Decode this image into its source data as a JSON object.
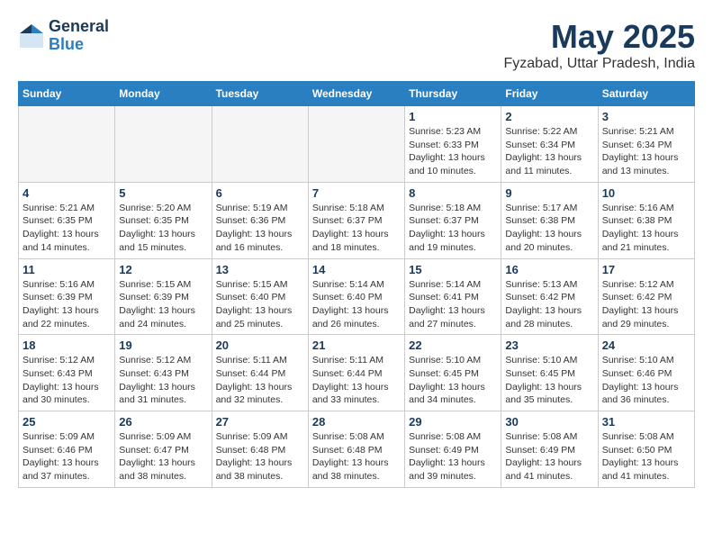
{
  "logo": {
    "general": "General",
    "blue": "Blue"
  },
  "title": "May 2025",
  "location": "Fyzabad, Uttar Pradesh, India",
  "days_of_week": [
    "Sunday",
    "Monday",
    "Tuesday",
    "Wednesday",
    "Thursday",
    "Friday",
    "Saturday"
  ],
  "weeks": [
    [
      {
        "day": "",
        "info": ""
      },
      {
        "day": "",
        "info": ""
      },
      {
        "day": "",
        "info": ""
      },
      {
        "day": "",
        "info": ""
      },
      {
        "day": "1",
        "info": "Sunrise: 5:23 AM\nSunset: 6:33 PM\nDaylight: 13 hours\nand 10 minutes."
      },
      {
        "day": "2",
        "info": "Sunrise: 5:22 AM\nSunset: 6:34 PM\nDaylight: 13 hours\nand 11 minutes."
      },
      {
        "day": "3",
        "info": "Sunrise: 5:21 AM\nSunset: 6:34 PM\nDaylight: 13 hours\nand 13 minutes."
      }
    ],
    [
      {
        "day": "4",
        "info": "Sunrise: 5:21 AM\nSunset: 6:35 PM\nDaylight: 13 hours\nand 14 minutes."
      },
      {
        "day": "5",
        "info": "Sunrise: 5:20 AM\nSunset: 6:35 PM\nDaylight: 13 hours\nand 15 minutes."
      },
      {
        "day": "6",
        "info": "Sunrise: 5:19 AM\nSunset: 6:36 PM\nDaylight: 13 hours\nand 16 minutes."
      },
      {
        "day": "7",
        "info": "Sunrise: 5:18 AM\nSunset: 6:37 PM\nDaylight: 13 hours\nand 18 minutes."
      },
      {
        "day": "8",
        "info": "Sunrise: 5:18 AM\nSunset: 6:37 PM\nDaylight: 13 hours\nand 19 minutes."
      },
      {
        "day": "9",
        "info": "Sunrise: 5:17 AM\nSunset: 6:38 PM\nDaylight: 13 hours\nand 20 minutes."
      },
      {
        "day": "10",
        "info": "Sunrise: 5:16 AM\nSunset: 6:38 PM\nDaylight: 13 hours\nand 21 minutes."
      }
    ],
    [
      {
        "day": "11",
        "info": "Sunrise: 5:16 AM\nSunset: 6:39 PM\nDaylight: 13 hours\nand 22 minutes."
      },
      {
        "day": "12",
        "info": "Sunrise: 5:15 AM\nSunset: 6:39 PM\nDaylight: 13 hours\nand 24 minutes."
      },
      {
        "day": "13",
        "info": "Sunrise: 5:15 AM\nSunset: 6:40 PM\nDaylight: 13 hours\nand 25 minutes."
      },
      {
        "day": "14",
        "info": "Sunrise: 5:14 AM\nSunset: 6:40 PM\nDaylight: 13 hours\nand 26 minutes."
      },
      {
        "day": "15",
        "info": "Sunrise: 5:14 AM\nSunset: 6:41 PM\nDaylight: 13 hours\nand 27 minutes."
      },
      {
        "day": "16",
        "info": "Sunrise: 5:13 AM\nSunset: 6:42 PM\nDaylight: 13 hours\nand 28 minutes."
      },
      {
        "day": "17",
        "info": "Sunrise: 5:12 AM\nSunset: 6:42 PM\nDaylight: 13 hours\nand 29 minutes."
      }
    ],
    [
      {
        "day": "18",
        "info": "Sunrise: 5:12 AM\nSunset: 6:43 PM\nDaylight: 13 hours\nand 30 minutes."
      },
      {
        "day": "19",
        "info": "Sunrise: 5:12 AM\nSunset: 6:43 PM\nDaylight: 13 hours\nand 31 minutes."
      },
      {
        "day": "20",
        "info": "Sunrise: 5:11 AM\nSunset: 6:44 PM\nDaylight: 13 hours\nand 32 minutes."
      },
      {
        "day": "21",
        "info": "Sunrise: 5:11 AM\nSunset: 6:44 PM\nDaylight: 13 hours\nand 33 minutes."
      },
      {
        "day": "22",
        "info": "Sunrise: 5:10 AM\nSunset: 6:45 PM\nDaylight: 13 hours\nand 34 minutes."
      },
      {
        "day": "23",
        "info": "Sunrise: 5:10 AM\nSunset: 6:45 PM\nDaylight: 13 hours\nand 35 minutes."
      },
      {
        "day": "24",
        "info": "Sunrise: 5:10 AM\nSunset: 6:46 PM\nDaylight: 13 hours\nand 36 minutes."
      }
    ],
    [
      {
        "day": "25",
        "info": "Sunrise: 5:09 AM\nSunset: 6:46 PM\nDaylight: 13 hours\nand 37 minutes."
      },
      {
        "day": "26",
        "info": "Sunrise: 5:09 AM\nSunset: 6:47 PM\nDaylight: 13 hours\nand 38 minutes."
      },
      {
        "day": "27",
        "info": "Sunrise: 5:09 AM\nSunset: 6:48 PM\nDaylight: 13 hours\nand 38 minutes."
      },
      {
        "day": "28",
        "info": "Sunrise: 5:08 AM\nSunset: 6:48 PM\nDaylight: 13 hours\nand 38 minutes."
      },
      {
        "day": "29",
        "info": "Sunrise: 5:08 AM\nSunset: 6:49 PM\nDaylight: 13 hours\nand 39 minutes."
      },
      {
        "day": "30",
        "info": "Sunrise: 5:08 AM\nSunset: 6:49 PM\nDaylight: 13 hours\nand 41 minutes."
      },
      {
        "day": "31",
        "info": "Sunrise: 5:08 AM\nSunset: 6:50 PM\nDaylight: 13 hours\nand 41 minutes."
      }
    ]
  ]
}
